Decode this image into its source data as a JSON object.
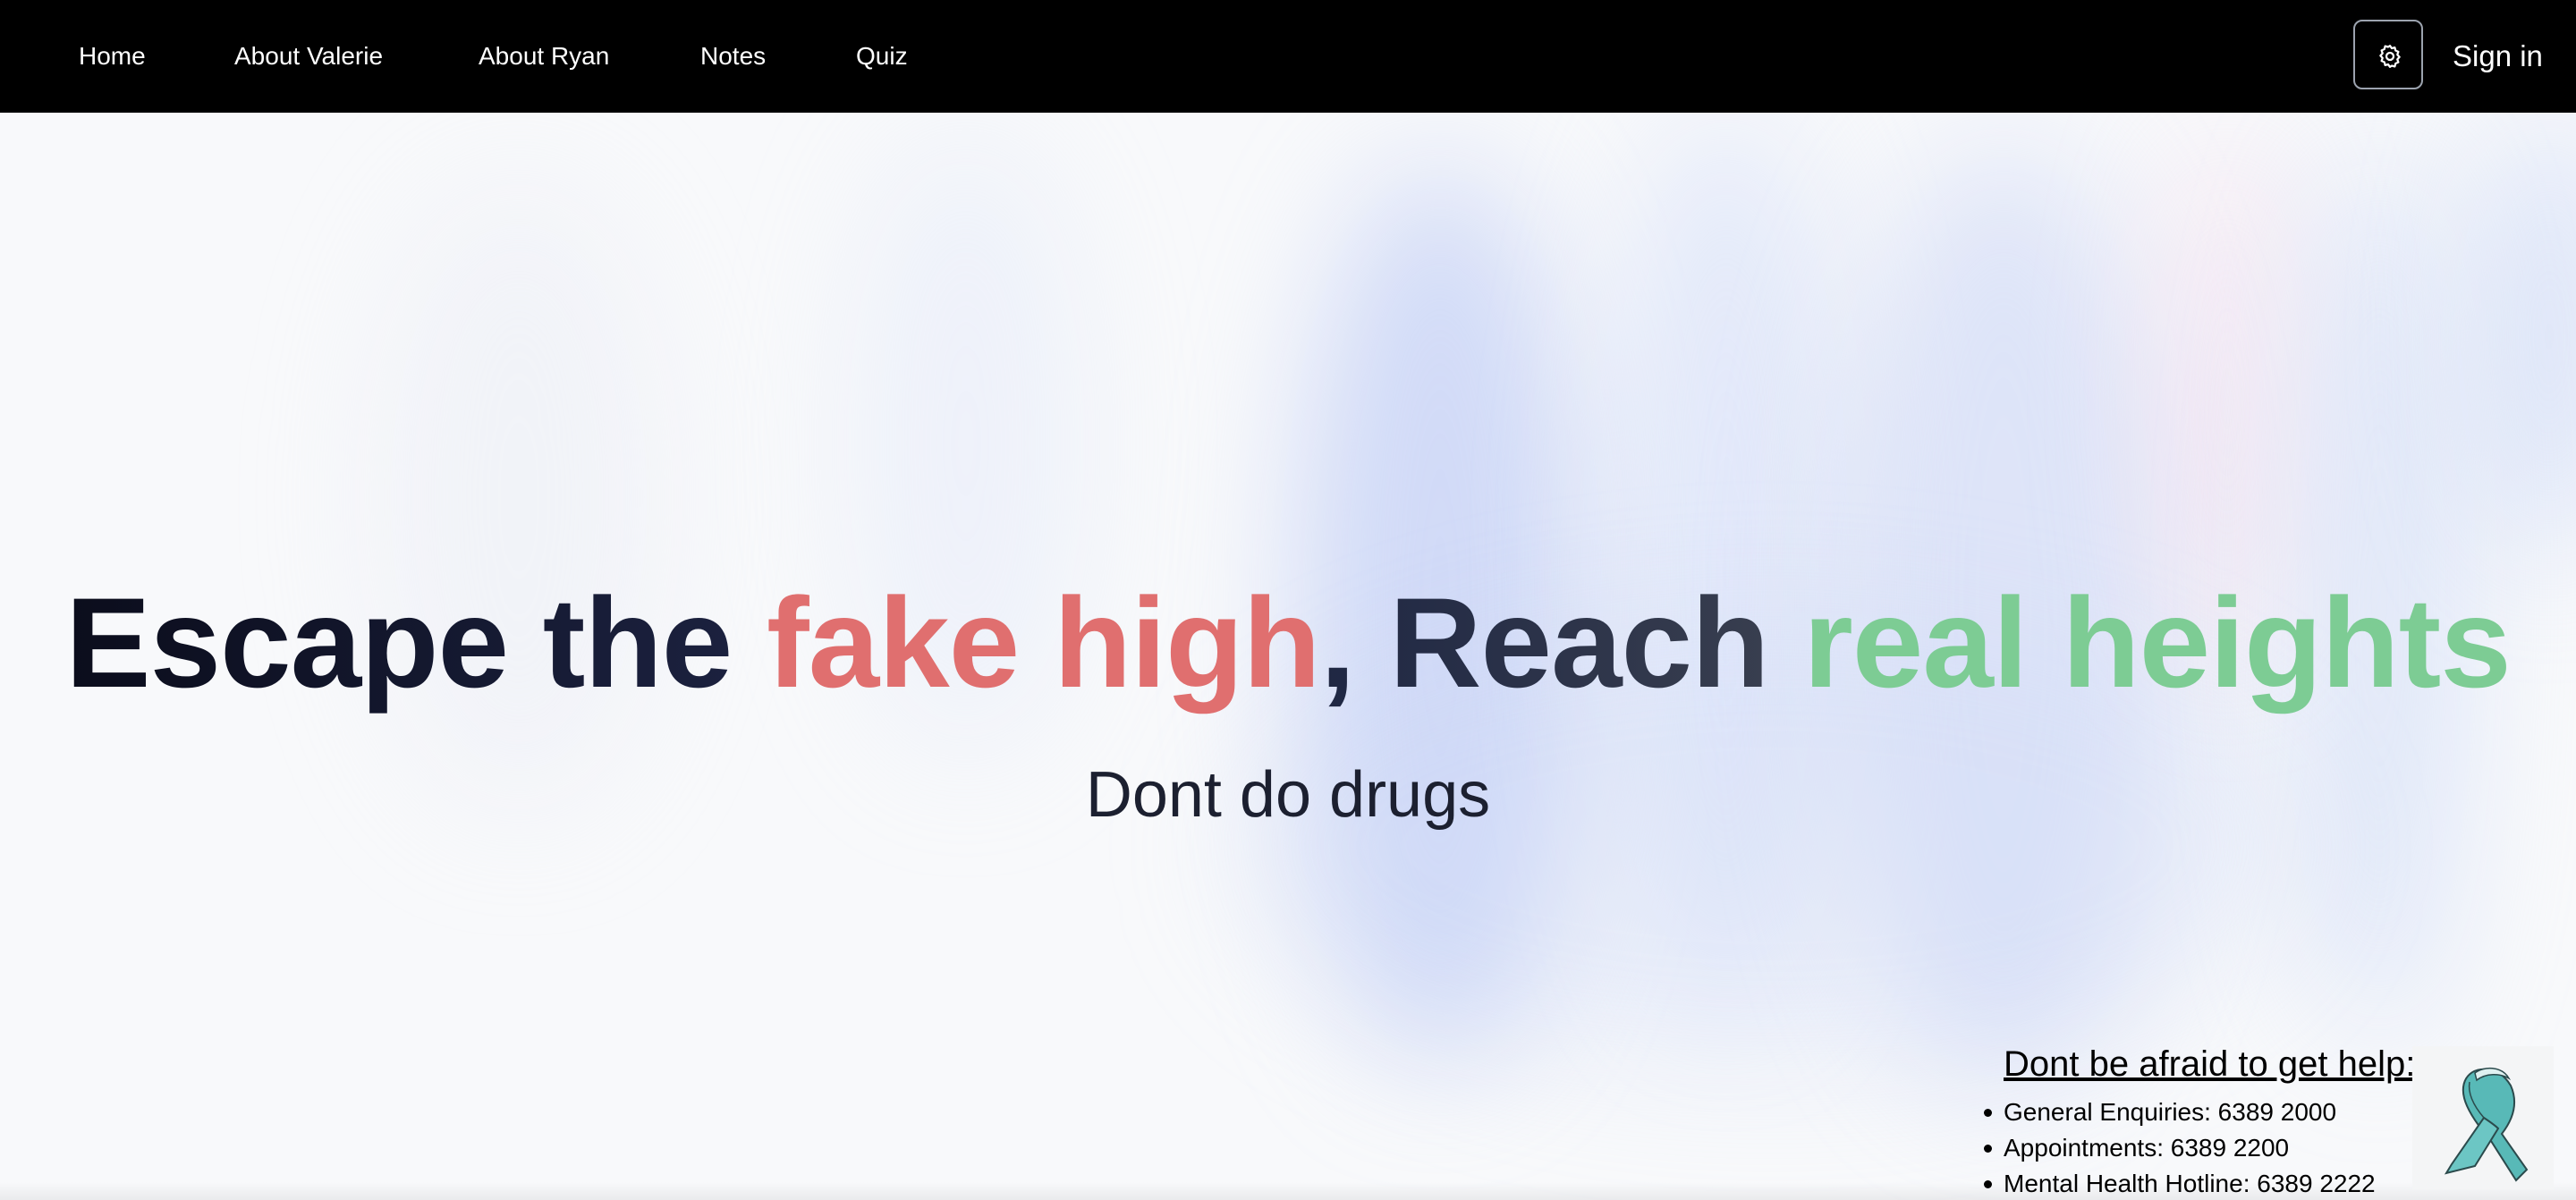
{
  "nav": {
    "links": [
      "Home",
      "About Valerie",
      "About Ryan",
      "Notes",
      "Quiz"
    ],
    "settings_icon": "gear-icon",
    "sign_in": "Sign in"
  },
  "hero": {
    "title_part1": "Escape the ",
    "title_part2": "fake high",
    "title_part3": ", Reach ",
    "title_part4": "real heights",
    "subtitle": "Dont do drugs",
    "colors": {
      "fake_high": "#e06f6f",
      "real_heights": "#7dcc94",
      "dark_text": "#0b0d1c"
    }
  },
  "help": {
    "title": "Dont be afraid to get help:",
    "items": [
      "General Enquiries: 6389 2000",
      "Appointments: 6389 2200",
      "Mental Health Hotline: 6389 2222"
    ],
    "ribbon_icon": "awareness-ribbon-icon",
    "ribbon_color": "#5bbcbc"
  }
}
